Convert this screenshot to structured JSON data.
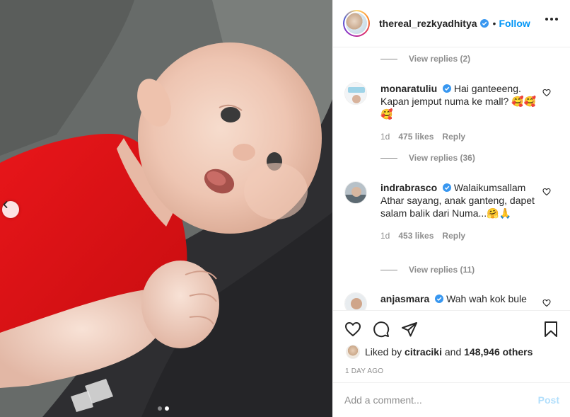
{
  "header": {
    "username": "thereal_rezkyadhitya",
    "separator": "•",
    "follow_label": "Follow",
    "more_icon": "more-horizontal-icon"
  },
  "comments": {
    "replies": [
      {
        "label": "View replies (2)"
      },
      {
        "label": "View replies (36)"
      },
      {
        "label": "View replies (11)"
      }
    ],
    "items": [
      {
        "username": "monaratuliu",
        "text": "Hai ganteeeng. Kapan jemput numa ke mall? 🥰🥰🥰",
        "age": "1d",
        "likes": "475 likes",
        "reply": "Reply"
      },
      {
        "username": "indrabrasco",
        "text": "Walaikumsallam Athar sayang, anak ganteng, dapet salam balik dari Numa...🤗🙏",
        "age": "1d",
        "likes": "453 likes",
        "reply": "Reply"
      },
      {
        "username": "anjasmara",
        "text": "Wah wah kok bule",
        "age": "",
        "likes": "",
        "reply": ""
      }
    ]
  },
  "actions": {
    "icons": [
      "heart-icon",
      "comment-icon",
      "share-icon",
      "bookmark-icon"
    ],
    "liked_prefix": "Liked by",
    "liked_user": "citraciki",
    "liked_and": "and",
    "liked_others": "148,946 others",
    "timestamp": "1 DAY AGO"
  },
  "add_comment": {
    "placeholder": "Add a comment...",
    "post_label": "Post"
  },
  "carousel": {
    "current_index": 2,
    "total": 2
  },
  "colors": {
    "accent": "#0095f6",
    "verified": "#3897f0",
    "post_disabled": "#b2dffc",
    "muted": "#8e8e8e"
  }
}
